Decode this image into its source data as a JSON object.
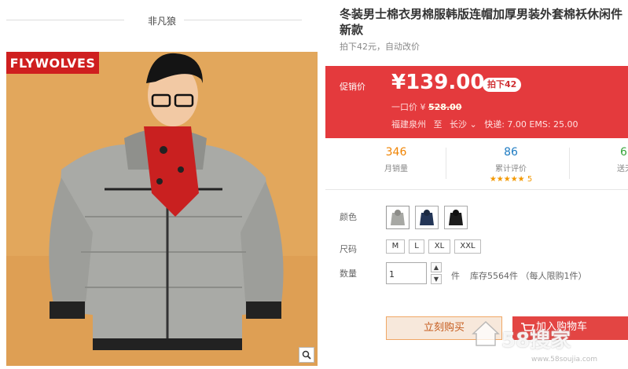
{
  "brand_header": {
    "name": "非凡狼"
  },
  "product_image": {
    "logo": "FLYWOLVES",
    "zoom_icon": "magnifier-icon"
  },
  "product": {
    "title": "冬装男士棉衣男棉服韩版连帽加厚男装外套棉袄休闲件新款",
    "subtitle": "拍下42元，自动改价"
  },
  "price": {
    "promo_label": "促销价",
    "current": "¥139.00",
    "badge": "拍下42",
    "original_prefix": "一口价 ¥",
    "original_value": "528.00",
    "ship_from": "福建泉州",
    "ship_to_label": "至",
    "ship_to": "长沙",
    "shipping": "快递: 7.00 EMS: 25.00"
  },
  "stats": [
    {
      "value": "346",
      "label": "月销量",
      "color": "#f08300"
    },
    {
      "value": "86",
      "label": "累计评价",
      "color": "#1e7bc2",
      "stars": "★★★★★ 5"
    },
    {
      "value": "6",
      "label": "送天猫",
      "color": "#37a53a"
    }
  ],
  "options": {
    "color_label": "颜色",
    "size_label": "尺码",
    "sizes": [
      "M",
      "L",
      "XL",
      "XXL"
    ],
    "qty_label": "数量",
    "qty_value": "1",
    "unit": "件",
    "stock": "库存5564件 （每人限购1件）"
  },
  "actions": {
    "buy_now": "立刻购买",
    "add_to_cart": "加入购物车"
  },
  "watermark": {
    "text": "58搜家",
    "sub": "www.58soujia.com"
  },
  "colors": {
    "price_bg": "#e43a3d",
    "accent_orange": "#f08300",
    "blue": "#1e7bc2"
  }
}
